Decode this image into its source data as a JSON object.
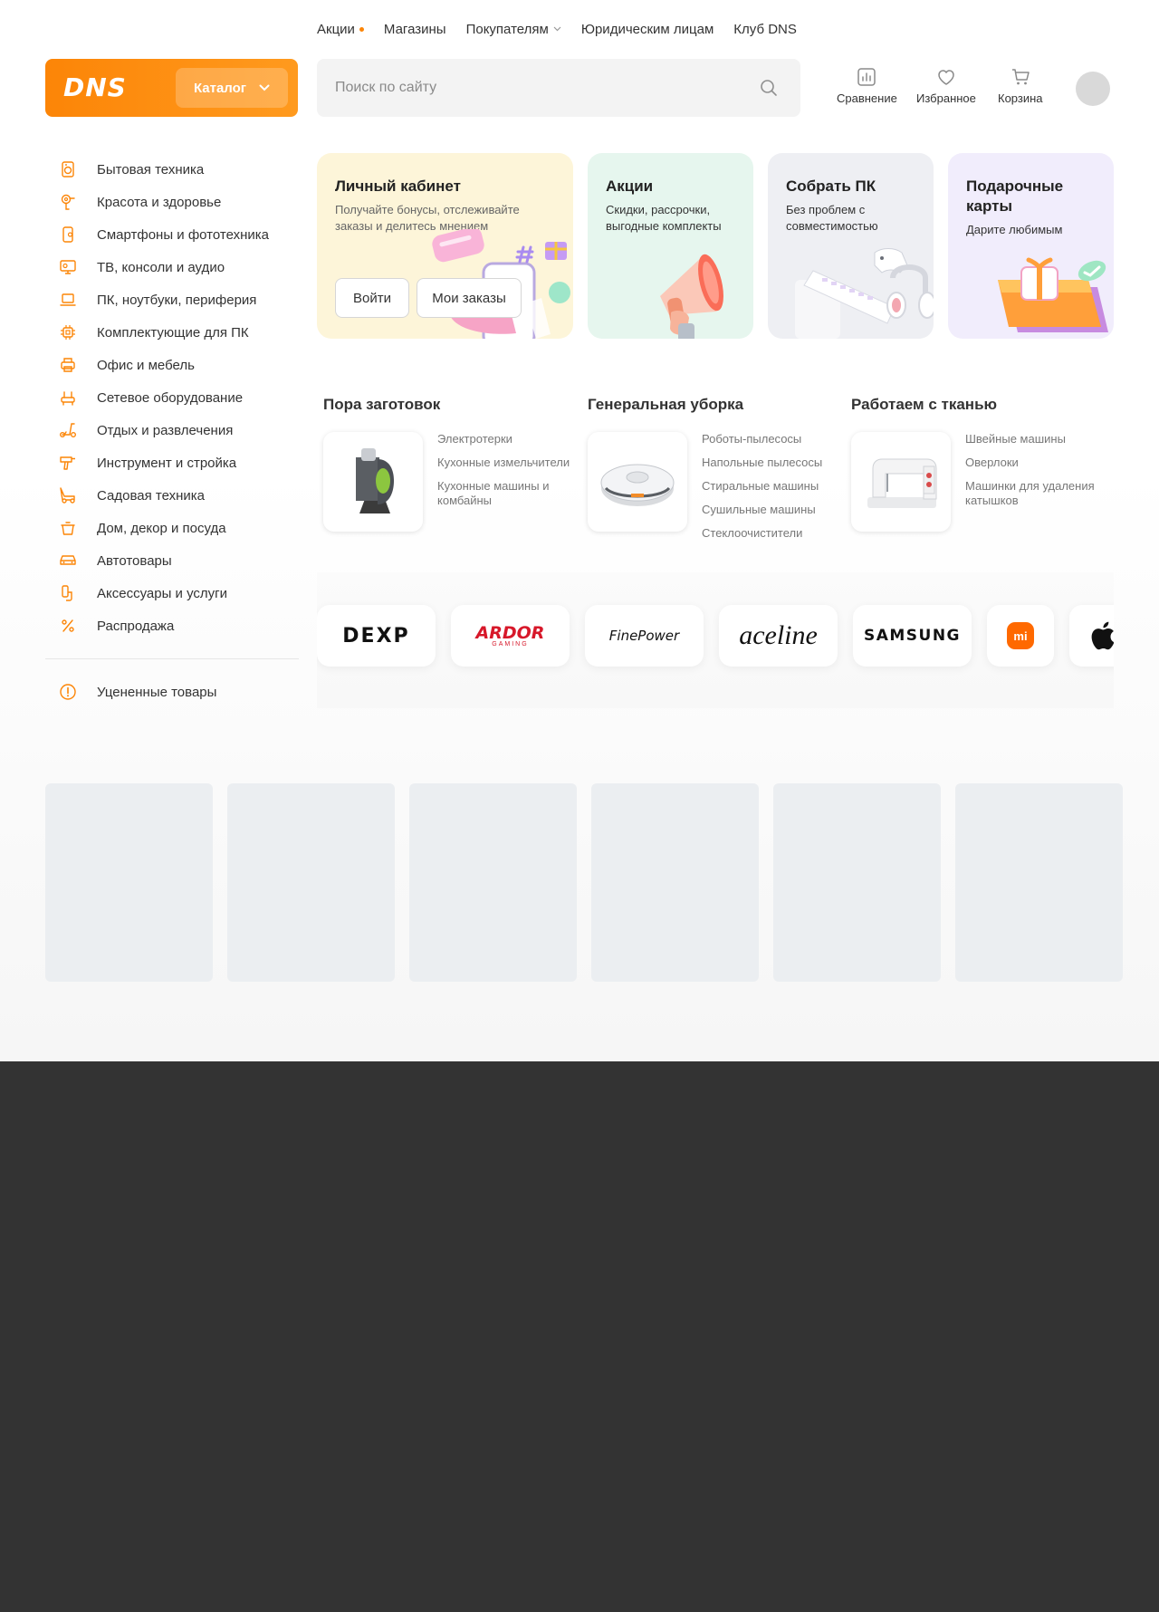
{
  "top_nav": {
    "promo": "Акции",
    "stores": "Магазины",
    "customers": "Покупателям",
    "business": "Юридическим лицам",
    "club": "Клуб DNS"
  },
  "header": {
    "logo": "DNS",
    "catalog_label": "Каталог",
    "search_placeholder": "Поиск по сайту",
    "compare_label": "Сравнение",
    "favorites_label": "Избранное",
    "cart_label": "Корзина"
  },
  "sidebar": {
    "items": [
      {
        "label": "Бытовая техника",
        "icon": "washing-machine-icon"
      },
      {
        "label": "Красота и здоровье",
        "icon": "hair-dryer-icon"
      },
      {
        "label": "Смартфоны и фототехника",
        "icon": "smartphone-icon"
      },
      {
        "label": "ТВ, консоли и аудио",
        "icon": "tv-icon"
      },
      {
        "label": "ПК, ноутбуки, периферия",
        "icon": "laptop-icon"
      },
      {
        "label": "Комплектующие для ПК",
        "icon": "chip-icon"
      },
      {
        "label": "Офис и мебель",
        "icon": "printer-icon"
      },
      {
        "label": "Сетевое оборудование",
        "icon": "router-icon"
      },
      {
        "label": "Отдых и развлечения",
        "icon": "scooter-icon"
      },
      {
        "label": "Инструмент и стройка",
        "icon": "drill-icon"
      },
      {
        "label": "Садовая техника",
        "icon": "lawn-mower-icon"
      },
      {
        "label": "Дом, декор и посуда",
        "icon": "pot-icon"
      },
      {
        "label": "Автотовары",
        "icon": "car-icon"
      },
      {
        "label": "Аксессуары и услуги",
        "icon": "accessories-icon"
      },
      {
        "label": "Распродажа",
        "icon": "percent-icon"
      }
    ],
    "discounted": {
      "label": "Уцененные товары",
      "icon": "exclamation-circle-icon"
    }
  },
  "cards": {
    "account": {
      "title": "Личный кабинет",
      "subtitle": "Получайте бонусы, отслеживайте заказы и делитесь мнением",
      "login_button": "Войти",
      "orders_button": "Мои заказы",
      "bg": "#fdf5d9"
    },
    "promo": {
      "title": "Акции",
      "subtitle": "Скидки, рассрочки, выгодные комплекты",
      "bg": "#e6f6ee"
    },
    "build_pc": {
      "title": "Собрать ПК",
      "subtitle": "Без проблем с совместимостью",
      "bg": "#eeeff3"
    },
    "gift_cards": {
      "title": "Подарочные карты",
      "subtitle": "Дарите любимым",
      "bg": "#f1edfc"
    }
  },
  "groups": [
    {
      "title": "Пора заготовок",
      "links": [
        "Электротерки",
        "Кухонные измельчители",
        "Кухонные машины и комбайны"
      ]
    },
    {
      "title": "Генеральная уборка",
      "links": [
        "Роботы-пылесосы",
        "Напольные пылесосы",
        "Стиральные машины",
        "Сушильные машины",
        "Стеклоочистители"
      ]
    },
    {
      "title": "Работаем с тканью",
      "links": [
        "Швейные машины",
        "Оверлоки",
        "Машинки для удаления катышков"
      ]
    }
  ],
  "brands": {
    "dexp": "DEXP",
    "ardor": "ARDOR",
    "ardor_sub": "GAMING",
    "finepower": "FinePower",
    "aceline": "aceline",
    "samsung": "SAMSUNG",
    "xiaomi": "mi"
  },
  "colors": {
    "accent": "#fc8507",
    "footer": "#333333"
  }
}
